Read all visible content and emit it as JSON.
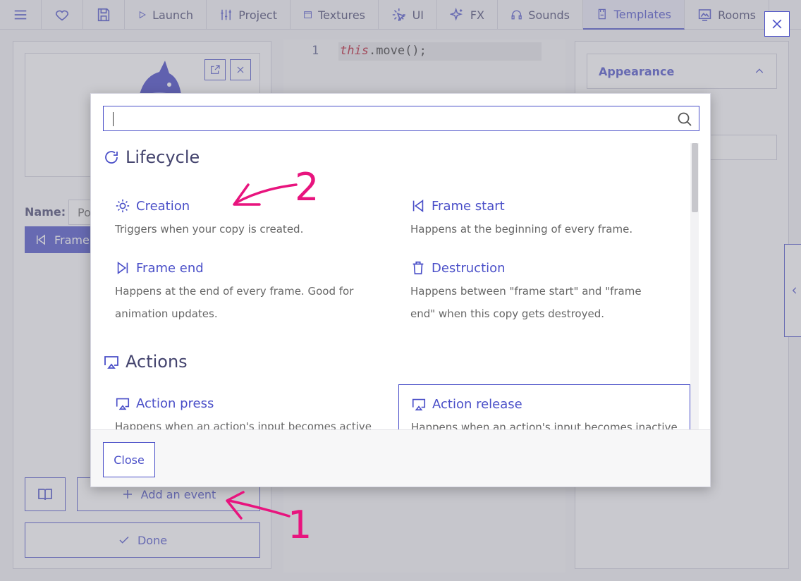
{
  "nav": {
    "items": [
      {
        "label": "",
        "icon": "menu-icon"
      },
      {
        "label": "",
        "icon": "heart-icon"
      },
      {
        "label": "",
        "icon": "save-icon"
      },
      {
        "label": "Launch",
        "icon": "play-icon"
      },
      {
        "label": "Project",
        "icon": "sliders-icon"
      },
      {
        "label": "Textures",
        "icon": "texture-icon"
      },
      {
        "label": "UI",
        "icon": "ui-icon"
      },
      {
        "label": "FX",
        "icon": "sparkles-icon"
      },
      {
        "label": "Sounds",
        "icon": "headphones-icon"
      },
      {
        "label": "Templates",
        "icon": "template-icon"
      },
      {
        "label": "Rooms",
        "icon": "rooms-icon"
      }
    ],
    "active": "Templates"
  },
  "left_panel": {
    "name_label": "Name:",
    "name_value": "Po",
    "selected_event": "Frame",
    "add_event_label": "Add an event",
    "done_label": "Done"
  },
  "editor": {
    "line_number": "1",
    "code_keyword": "this",
    "code_rest": ".move();"
  },
  "right_panel": {
    "appearance_label": "Appearance"
  },
  "modal": {
    "search": {
      "value": "",
      "placeholder": ""
    },
    "sections": [
      {
        "title": "Lifecycle",
        "icon": "refresh-icon",
        "events": [
          {
            "title": "Creation",
            "icon": "sun-icon",
            "description": "Triggers when your copy is created."
          },
          {
            "title": "Frame start",
            "icon": "skip-back-icon",
            "description": "Happens at the beginning of every frame."
          },
          {
            "title": "Frame end",
            "icon": "skip-forward-icon",
            "description": "Happens at the end of every frame. Good for animation updates."
          },
          {
            "title": "Destruction",
            "icon": "trash-icon",
            "description": "Happens between \"frame start\" and \"frame end\" when this copy gets destroyed."
          }
        ]
      },
      {
        "title": "Actions",
        "icon": "cast-icon",
        "events": [
          {
            "title": "Action press",
            "icon": "cast-icon",
            "description": "Happens when an action's input becomes active —"
          },
          {
            "title": "Action release",
            "icon": "cast-icon",
            "description": "Happens when an action's input becomes inactive"
          }
        ]
      }
    ],
    "close_label": "Close"
  },
  "annotations": {
    "arrow1_label": "1",
    "arrow2_label": "2",
    "color": "#e8147e"
  },
  "colors": {
    "accent": "#4a4fc8",
    "annotation": "#e8147e"
  }
}
